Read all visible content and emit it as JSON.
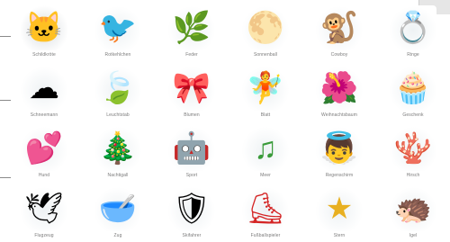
{
  "captions": [
    [
      "Schildkröte",
      "Rotkehlchen",
      "Feder",
      "Sonnenball",
      "Cowboy",
      "Ringe"
    ],
    [
      "Schneemann",
      "Leuchtstab",
      "Blumen",
      "Blatt",
      "Weihnachtsbaum",
      "Geschenk"
    ],
    [
      "Hund",
      "Nachtigall",
      "Sport",
      "Meer",
      "Regenschirm",
      "Hirsch"
    ],
    [
      "Flugzeug",
      "Zug",
      "Skifahrer",
      "Fußballspieler",
      "Stern",
      "Igel"
    ]
  ],
  "icons": [
    [
      "cat-face-icon",
      "robin-bird-icon",
      "wave-leaf-icon",
      "sun-ball-icon",
      "monkey-icon",
      "rings-icon"
    ],
    [
      "cloud-icon",
      "leaf-icon",
      "ribbon-knot-icon",
      "fairy-icon",
      "flowers-icon",
      "cupcake-icon"
    ],
    [
      "heart-icon",
      "christmas-tree-icon",
      "robot-icon",
      "music-note-icon",
      "angel-icon",
      "coral-icon"
    ],
    [
      "dove-icon",
      "bowl-icon",
      "shield-icon",
      "skater-icon",
      "star-icon",
      "hedgehog-icon"
    ]
  ]
}
